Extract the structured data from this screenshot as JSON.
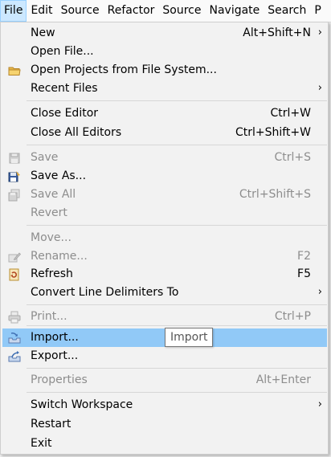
{
  "menubar": {
    "items": [
      "File",
      "Edit",
      "Source",
      "Refactor",
      "Source",
      "Navigate",
      "Search",
      "P"
    ]
  },
  "menu": {
    "new": {
      "label": "New",
      "shortcut": "Alt+Shift+N"
    },
    "open_file": {
      "label": "Open File..."
    },
    "open_projects": {
      "label": "Open Projects from File System..."
    },
    "recent_files": {
      "label": "Recent Files"
    },
    "close_editor": {
      "label": "Close Editor",
      "shortcut": "Ctrl+W"
    },
    "close_all_editors": {
      "label": "Close All Editors",
      "shortcut": "Ctrl+Shift+W"
    },
    "save": {
      "label": "Save",
      "shortcut": "Ctrl+S"
    },
    "save_as": {
      "label": "Save As..."
    },
    "save_all": {
      "label": "Save All",
      "shortcut": "Ctrl+Shift+S"
    },
    "revert": {
      "label": "Revert"
    },
    "move": {
      "label": "Move..."
    },
    "rename": {
      "label": "Rename...",
      "shortcut": "F2"
    },
    "refresh": {
      "label": "Refresh",
      "shortcut": "F5"
    },
    "convert_line_delimiters": {
      "label": "Convert Line Delimiters To"
    },
    "print": {
      "label": "Print...",
      "shortcut": "Ctrl+P"
    },
    "import": {
      "label": "Import..."
    },
    "export": {
      "label": "Export..."
    },
    "properties": {
      "label": "Properties",
      "shortcut": "Alt+Enter"
    },
    "switch_workspace": {
      "label": "Switch Workspace"
    },
    "restart": {
      "label": "Restart"
    },
    "exit": {
      "label": "Exit"
    },
    "submenu_arrow": "›"
  },
  "tooltip": {
    "text": "Import"
  },
  "colors": {
    "highlight": "#91c9f7",
    "menubar_active": "#cce8ff",
    "disabled_text": "#8d8d8d",
    "menu_bg": "#f2f2f2"
  }
}
